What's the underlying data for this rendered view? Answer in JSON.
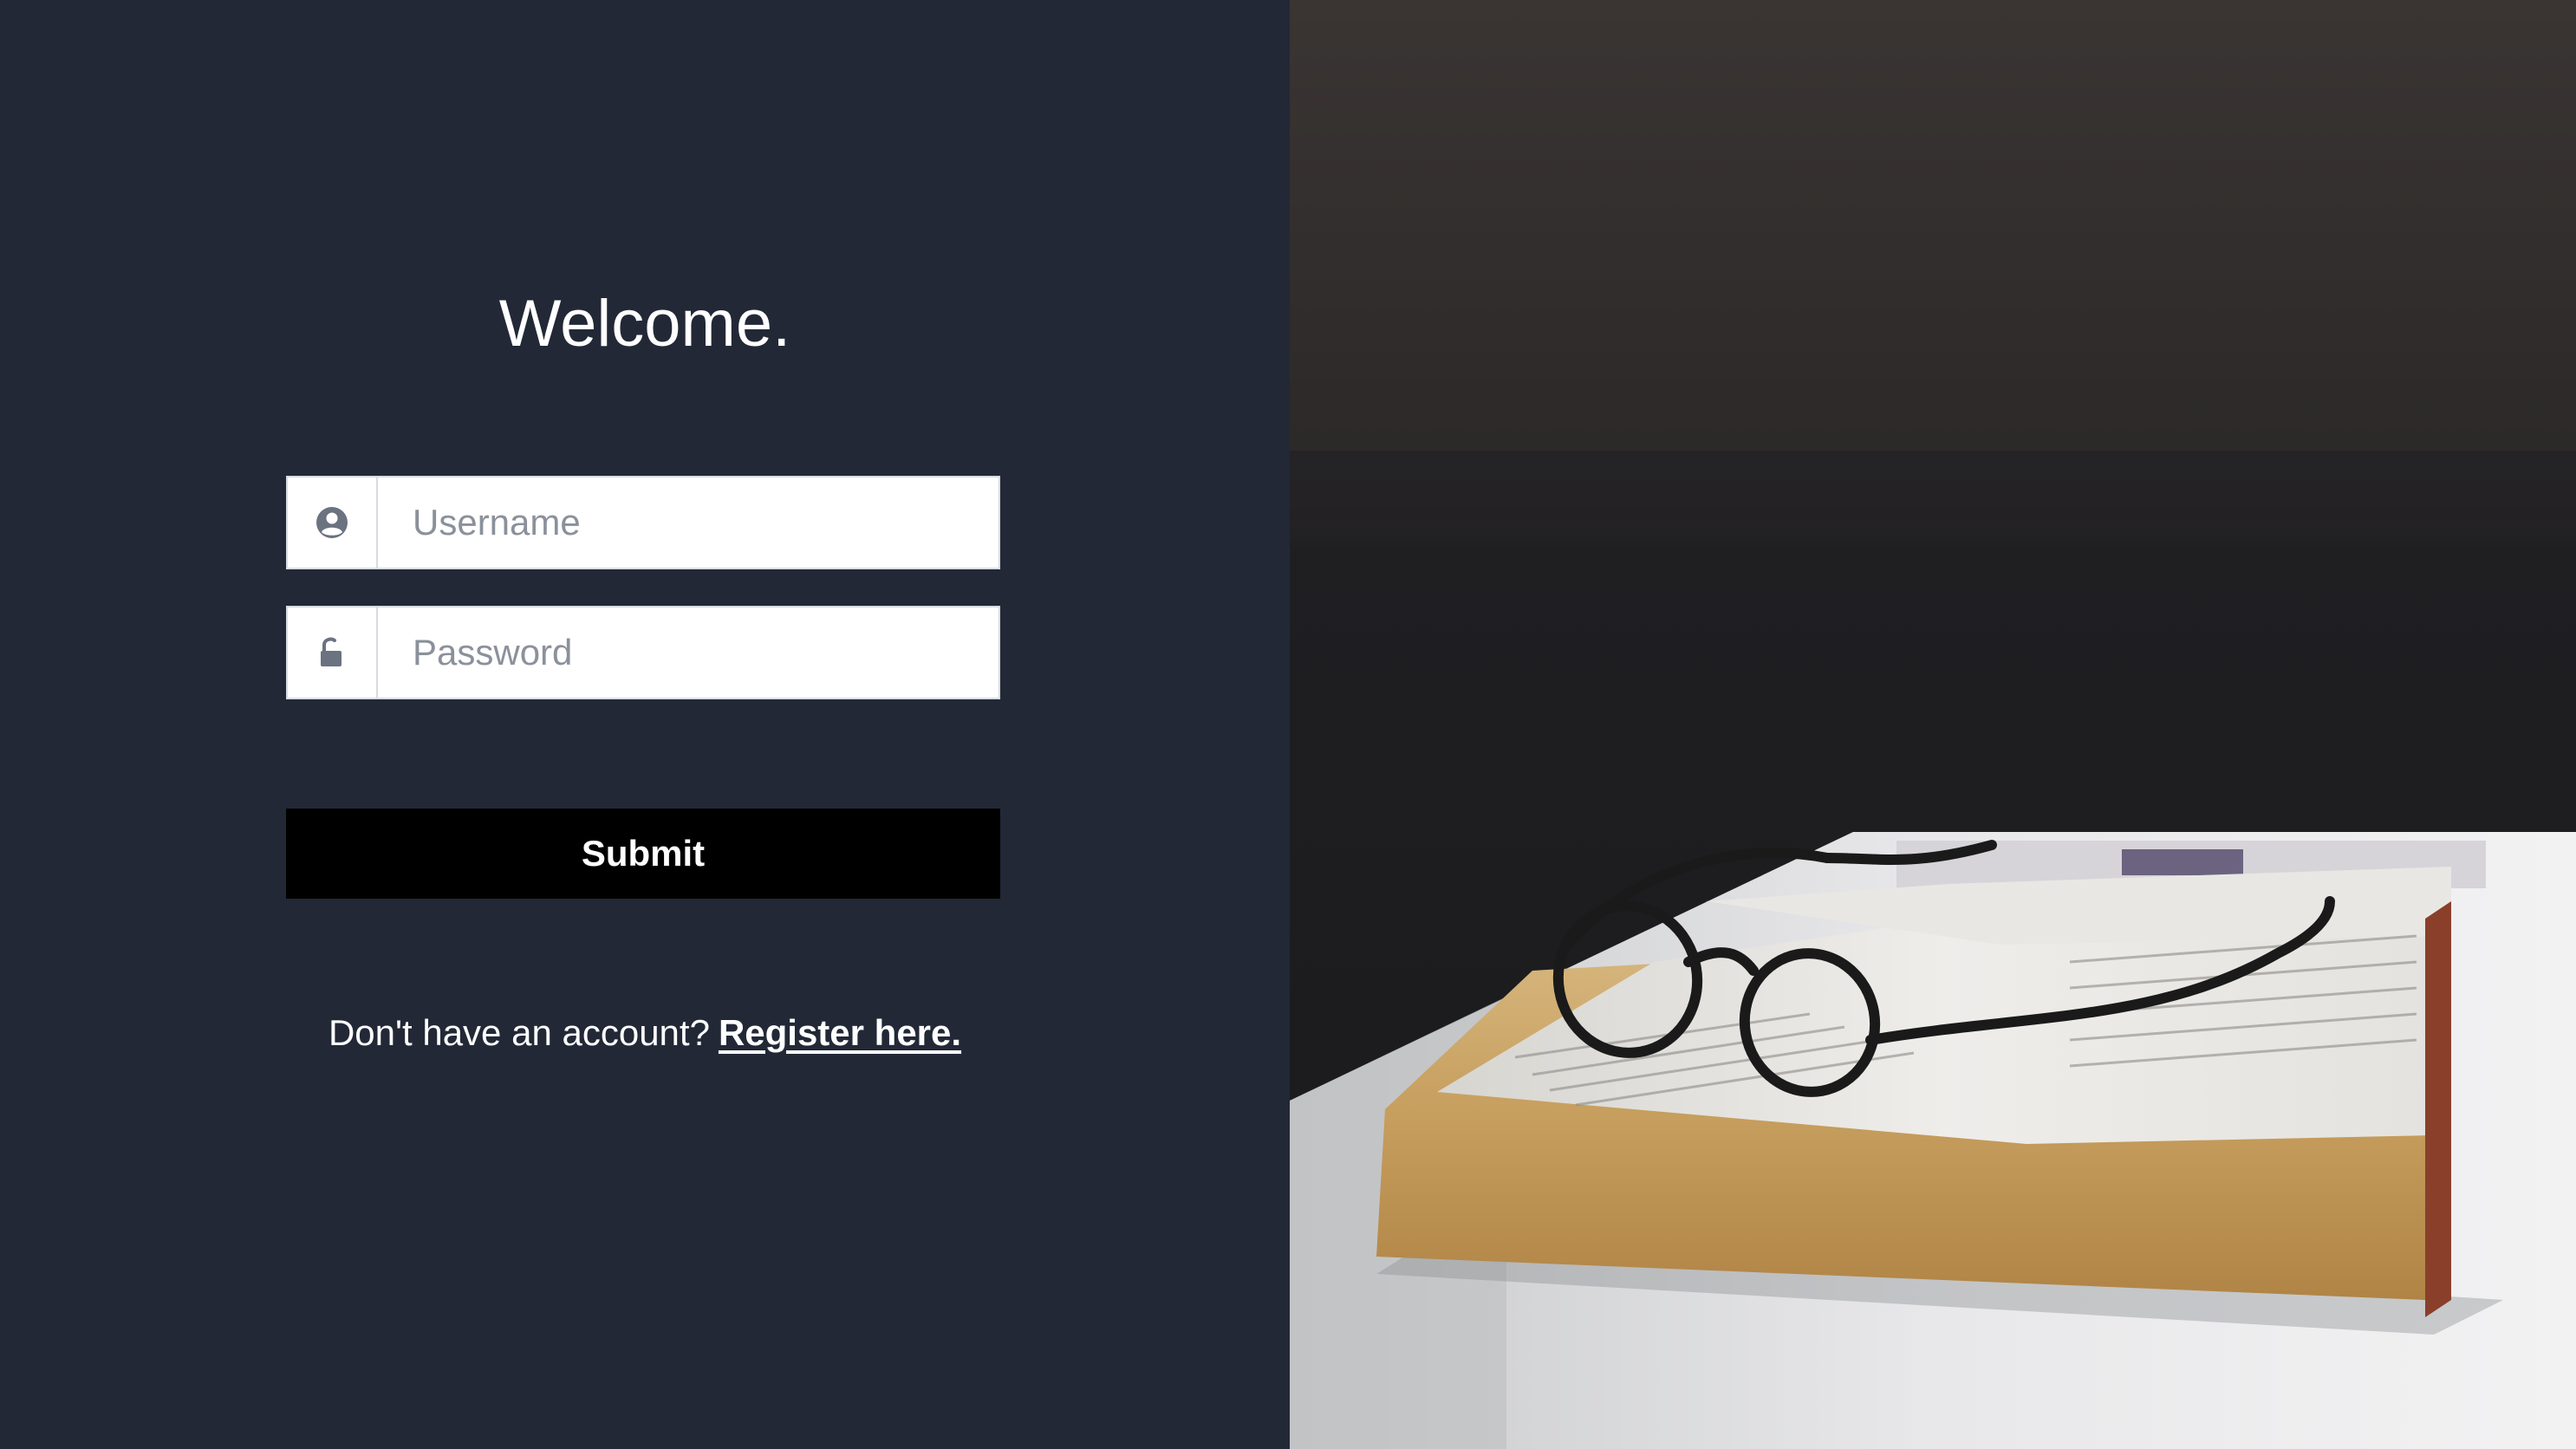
{
  "login": {
    "title": "Welcome.",
    "username": {
      "placeholder": "Username",
      "value": "",
      "icon": "user-circle-icon"
    },
    "password": {
      "placeholder": "Password",
      "value": "",
      "icon": "unlock-icon"
    },
    "submit_label": "Submit",
    "register_prompt": "Don't have an account?",
    "register_link": "Register here."
  },
  "theme": {
    "panel_bg": "#222836",
    "button_bg": "#000000",
    "text": "#ffffff",
    "placeholder": "#8b919b"
  },
  "hero_image": {
    "subject": "open book with reading glasses on a table"
  }
}
